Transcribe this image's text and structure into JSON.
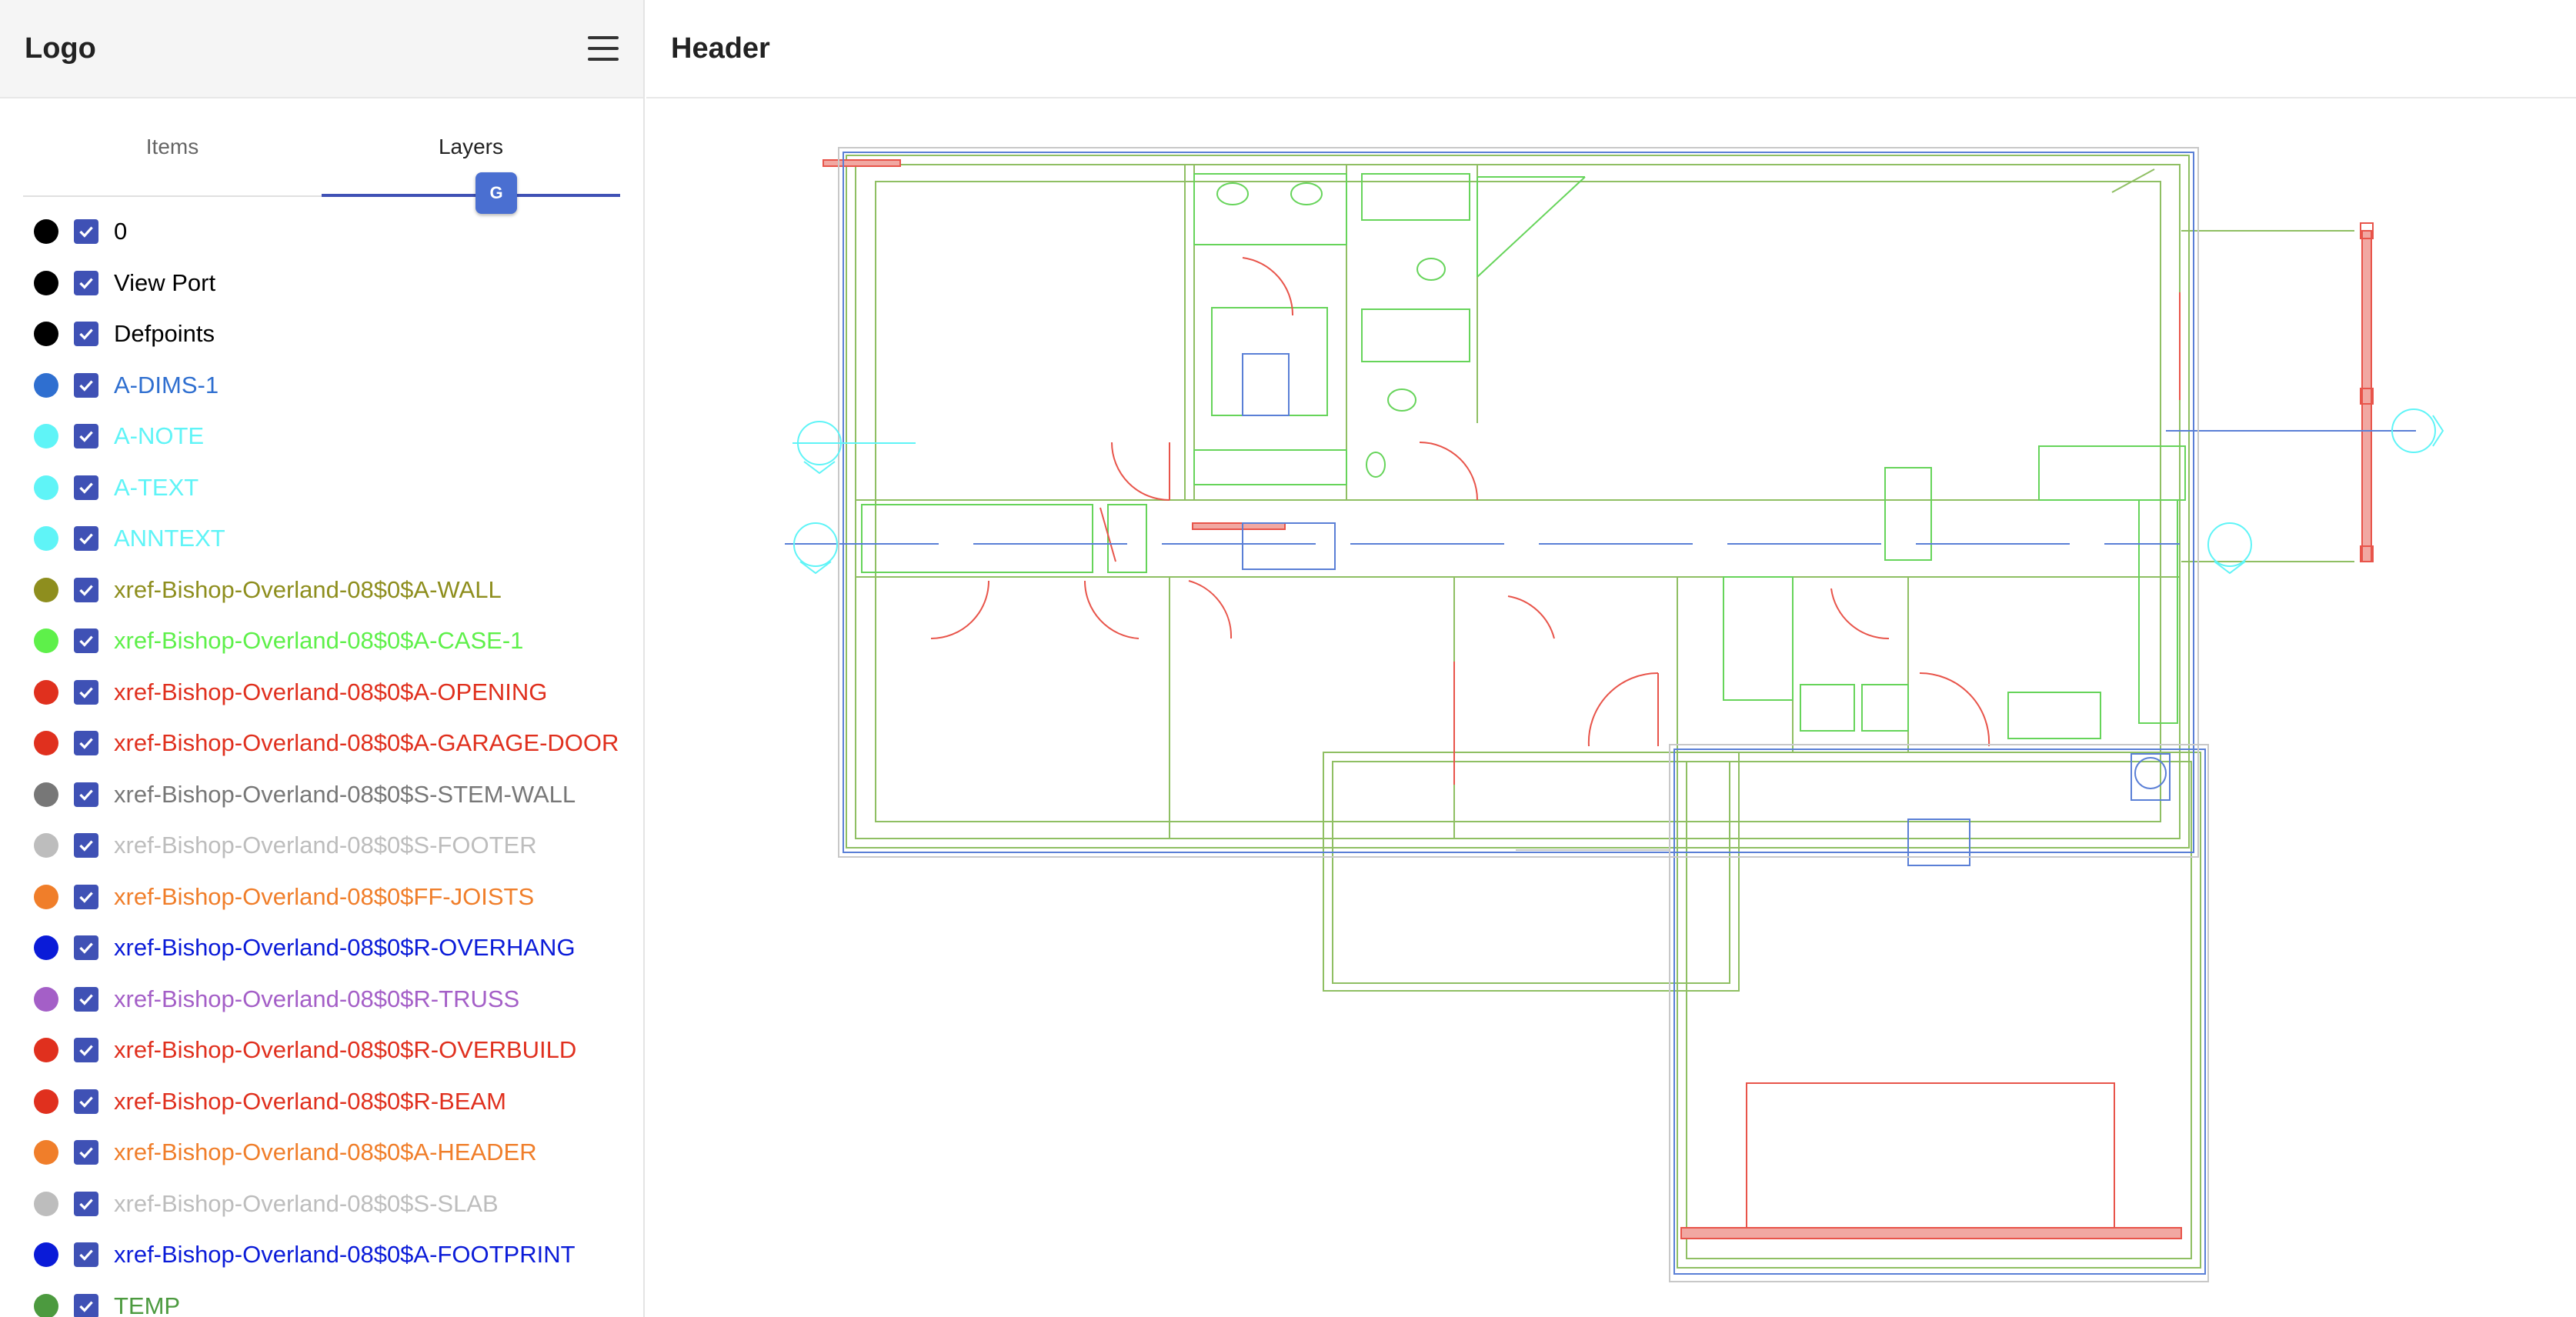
{
  "sidebar": {
    "logo": "Logo",
    "menu_icon": "hamburger-menu-icon",
    "tabs": [
      {
        "label": "Items",
        "active": false
      },
      {
        "label": "Layers",
        "active": true
      }
    ],
    "translate_icon": "google-translate-icon",
    "layers": [
      {
        "name": "0",
        "color": "#000000",
        "checked": true
      },
      {
        "name": "View Port",
        "color": "#000000",
        "checked": true
      },
      {
        "name": "Defpoints",
        "color": "#000000",
        "checked": true
      },
      {
        "name": "A-DIMS-1",
        "color": "#2f6fd0",
        "checked": true
      },
      {
        "name": "A-NOTE",
        "color": "#5ff4f7",
        "checked": true
      },
      {
        "name": "A-TEXT",
        "color": "#5ff4f7",
        "checked": true
      },
      {
        "name": "ANNTEXT",
        "color": "#5ff4f7",
        "checked": true
      },
      {
        "name": "xref-Bishop-Overland-08$0$A-WALL",
        "color": "#8e8e1e",
        "checked": true
      },
      {
        "name": "xref-Bishop-Overland-08$0$A-CASE-1",
        "color": "#5ef04a",
        "checked": true
      },
      {
        "name": "xref-Bishop-Overland-08$0$A-OPENING",
        "color": "#e0301e",
        "checked": true
      },
      {
        "name": "xref-Bishop-Overland-08$0$A-GARAGE-DOOR",
        "color": "#e0301e",
        "checked": true
      },
      {
        "name": "xref-Bishop-Overland-08$0$S-STEM-WALL",
        "color": "#777777",
        "checked": true
      },
      {
        "name": "xref-Bishop-Overland-08$0$S-FOOTER",
        "color": "#bdbdbd",
        "checked": true
      },
      {
        "name": "xref-Bishop-Overland-08$0$FF-JOISTS",
        "color": "#f07e2a",
        "checked": true
      },
      {
        "name": "xref-Bishop-Overland-08$0$R-OVERHANG",
        "color": "#0a1bd8",
        "checked": true
      },
      {
        "name": "xref-Bishop-Overland-08$0$R-TRUSS",
        "color": "#a45fc7",
        "checked": true
      },
      {
        "name": "xref-Bishop-Overland-08$0$R-OVERBUILD",
        "color": "#e0301e",
        "checked": true
      },
      {
        "name": "xref-Bishop-Overland-08$0$R-BEAM",
        "color": "#e0301e",
        "checked": true
      },
      {
        "name": "xref-Bishop-Overland-08$0$A-HEADER",
        "color": "#f07e2a",
        "checked": true
      },
      {
        "name": "xref-Bishop-Overland-08$0$S-SLAB",
        "color": "#bdbdbd",
        "checked": true
      },
      {
        "name": "xref-Bishop-Overland-08$0$A-FOOTPRINT",
        "color": "#0a1bd8",
        "checked": true
      },
      {
        "name": "TEMP",
        "color": "#4c9a3f",
        "checked": true
      }
    ]
  },
  "header": {
    "title": "Header"
  },
  "canvas": {
    "colors": {
      "wall": "#8fbf63",
      "case": "#66d45a",
      "opening": "#e8544a",
      "footprint": "#5a7fd6",
      "slab": "#c8c8c8",
      "note": "#5ff4f7",
      "dims": "#4d86e0"
    }
  }
}
